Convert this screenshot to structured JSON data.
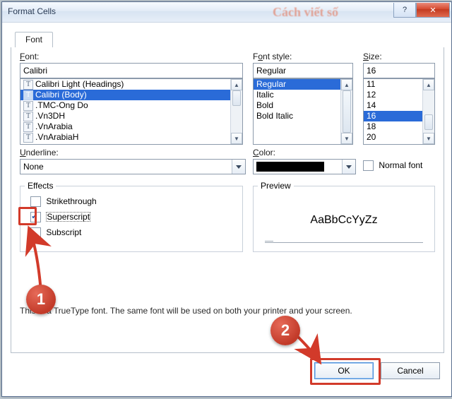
{
  "window": {
    "title": "Format Cells",
    "ghost_title": "Cách viết số"
  },
  "tab": {
    "font": "Font"
  },
  "labels": {
    "font": "Font:",
    "font_ul": "F",
    "style": "Font style:",
    "style_ul": "O",
    "size": "Size:",
    "size_ul": "S",
    "underline": "Underline:",
    "underline_ul": "U",
    "color": "Color:",
    "color_ul": "C",
    "normal_font": "Normal font",
    "normal_font_ul": "N",
    "effects": "Effects",
    "strike": "Strikethrough",
    "strike_ul": "K",
    "super": "Superscript",
    "super_ul": "E",
    "sub": "Subscript",
    "sub_ul": "B",
    "preview": "Preview"
  },
  "font_value": "Calibri",
  "font_list": [
    "Calibri Light (Headings)",
    "Calibri (Body)",
    ".TMC-Ong Do",
    ".Vn3DH",
    ".VnArabia",
    ".VnArabiaH"
  ],
  "font_selected_index": 1,
  "style_value": "Regular",
  "style_list": [
    "Regular",
    "Italic",
    "Bold",
    "Bold Italic"
  ],
  "style_selected_index": 0,
  "size_value": "16",
  "size_list": [
    "11",
    "12",
    "14",
    "16",
    "18",
    "20"
  ],
  "size_selected_index": 3,
  "underline_value": "None",
  "preview_text": "AaBbCcYyZz",
  "info_text": "This is a TrueType font.  The same font will be used on both your printer and your screen.",
  "buttons": {
    "ok": "OK",
    "cancel": "Cancel"
  },
  "annotations": {
    "badge1": "1",
    "badge2": "2"
  }
}
